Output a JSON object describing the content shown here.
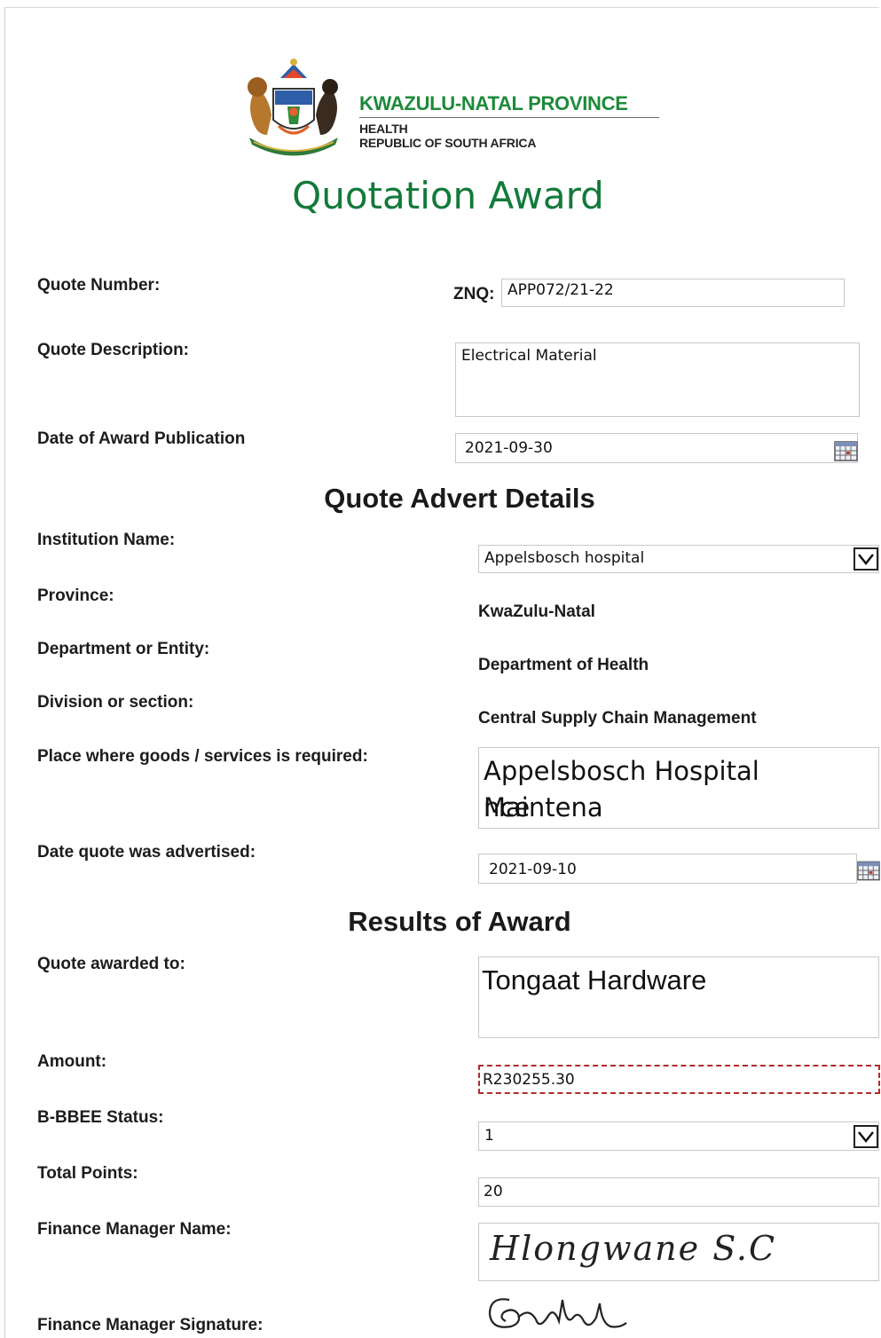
{
  "header": {
    "org_name": "KWAZULU-NATAL PROVINCE",
    "org_dept": "HEALTH",
    "org_country": "REPUBLIC OF SOUTH AFRICA",
    "title": "Quotation Award"
  },
  "quote": {
    "number_label": "Quote Number:",
    "number_prefix": "ZNQ:",
    "number_value": "APP072/21-22",
    "description_label": "Quote Description:",
    "description_value": "Electrical Material",
    "award_date_label": "Date of Award Publication",
    "award_date_value": "2021-09-30"
  },
  "advert": {
    "section_title": "Quote Advert Details",
    "institution_label": "Institution Name:",
    "institution_value": "Appelsbosch hospital",
    "province_label": "Province:",
    "province_value": "KwaZulu-Natal",
    "department_label": "Department or Entity:",
    "department_value": "Department of Health",
    "division_label": "Division or section:",
    "division_value": "Central Supply Chain Management",
    "place_label": "Place where goods /  services is required:",
    "place_value_line1": "Appelsbosch Hospital Maintena",
    "place_value_line2": "nce",
    "advertised_label": "Date quote was advertised:",
    "advertised_value": "2021-09-10"
  },
  "results": {
    "section_title": "Results of Award",
    "awarded_to_label": "Quote awarded to:",
    "awarded_to_value": "Tongaat Hardware",
    "amount_label": "Amount:",
    "amount_value": "R230255.30",
    "bbbee_label": "B-BBEE Status:",
    "bbbee_value": "1",
    "points_label": "Total Points:",
    "points_value": "20",
    "fm_name_label": "Finance Manager Name:",
    "fm_name_value": "Hlongwane  S.C",
    "fm_signature_label": "Finance Manager Signature:"
  },
  "icons": {
    "calendar": "calendar-icon",
    "dropdown": "chevron-down-icon",
    "crest": "coat-of-arms-icon"
  },
  "colors": {
    "brand_green": "#1d8a3a",
    "title_green": "#127a3a",
    "amount_border": "#b22a2a"
  }
}
